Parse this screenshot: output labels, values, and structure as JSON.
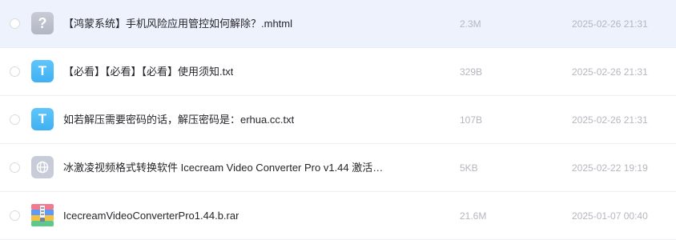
{
  "files": [
    {
      "icon": "unknown-file-icon",
      "icon_glyph": "?",
      "name": "【鸿蒙系统】手机风险应用管控如何解除？.mhtml",
      "size": "2.3M",
      "date": "2025-02-26 21:31"
    },
    {
      "icon": "text-file-icon",
      "icon_glyph": "T",
      "name": "【必看】【必看】【必看】使用须知.txt",
      "size": "329B",
      "date": "2025-02-26 21:31"
    },
    {
      "icon": "text-file-icon",
      "icon_glyph": "T",
      "name": "如若解压需要密码的话，解压密码是：erhua.cc.txt",
      "size": "107B",
      "date": "2025-02-26 21:31"
    },
    {
      "icon": "web-link-icon",
      "name": "冰激凌视频格式转换软件 Icecream Video Converter Pro v1.44 激活…",
      "size": "5KB",
      "date": "2025-02-22 19:19"
    },
    {
      "icon": "archive-file-icon",
      "name": "IcecreamVideoConverterPro1.44.b.rar",
      "size": "21.6M",
      "date": "2025-01-07 00:40"
    }
  ],
  "colors": {
    "highlight_row": "#eef2fd",
    "txt_icon": "#3fb0f3",
    "unknown_icon": "#b2b6c3",
    "meta_text": "#b4b7bf",
    "name_text": "#25262b"
  }
}
